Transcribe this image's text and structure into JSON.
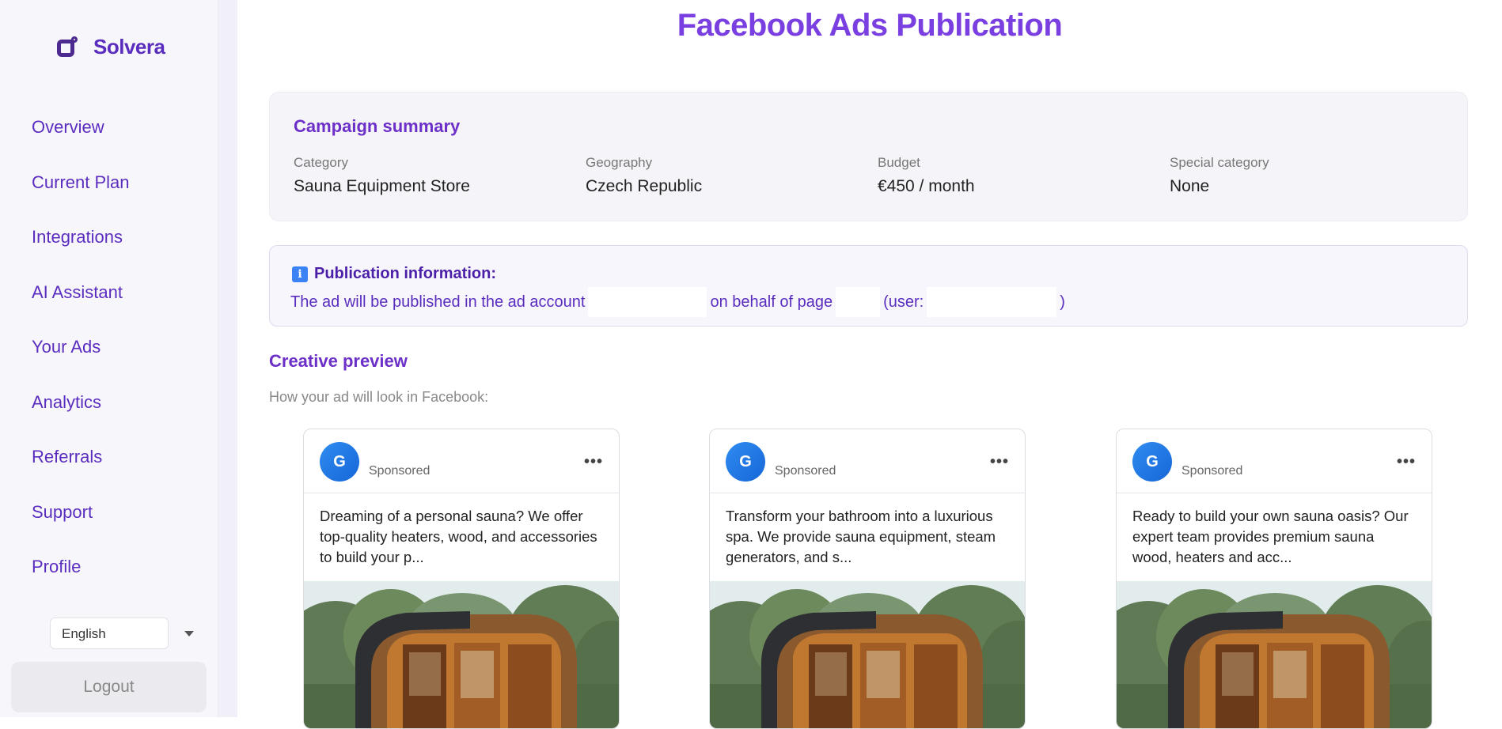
{
  "app": {
    "name": "Solvera"
  },
  "page": {
    "title": "Facebook Ads Publication"
  },
  "sidebar": {
    "items": [
      {
        "label": "Overview"
      },
      {
        "label": "Current Plan"
      },
      {
        "label": "Integrations"
      },
      {
        "label": "AI Assistant"
      },
      {
        "label": "Your Ads"
      },
      {
        "label": "Analytics"
      },
      {
        "label": "Referrals"
      },
      {
        "label": "Support"
      },
      {
        "label": "Profile"
      }
    ],
    "language": {
      "selected": "English"
    },
    "logout_label": "Logout"
  },
  "summary": {
    "title": "Campaign summary",
    "fields": [
      {
        "label": "Category",
        "value": "Sauna Equipment Store"
      },
      {
        "label": "Geography",
        "value": "Czech Republic"
      },
      {
        "label": "Budget",
        "value": "€450 / month"
      },
      {
        "label": "Special category",
        "value": "None"
      }
    ]
  },
  "publication": {
    "title": "Publication information:",
    "text_1": "The ad will be published in the ad account",
    "text_2": "on behalf of page",
    "text_3": "(user:",
    "text_4": ")"
  },
  "creative": {
    "title": "Creative preview",
    "subtitle": "How your ad will look in Facebook:",
    "cards": [
      {
        "avatar_letter": "G",
        "sponsored": "Sponsored",
        "text": "Dreaming of a personal sauna? We offer top-quality heaters, wood, and accessories to build your p..."
      },
      {
        "avatar_letter": "G",
        "sponsored": "Sponsored",
        "text": "Transform your bathroom into a luxurious spa. We provide sauna equipment, steam generators, and s..."
      },
      {
        "avatar_letter": "G",
        "sponsored": "Sponsored",
        "text": "Ready to build your own sauna oasis? Our expert team provides premium sauna wood, heaters and acc..."
      }
    ]
  },
  "colors": {
    "accent": "#5b2dbf",
    "title": "#7a3fe0",
    "facebook_blue": "#1877f2"
  },
  "icons": {
    "logo": "solvera-logo-icon",
    "info": "info-icon",
    "more": "more-horizontal-icon",
    "caret": "chevron-down-icon"
  }
}
